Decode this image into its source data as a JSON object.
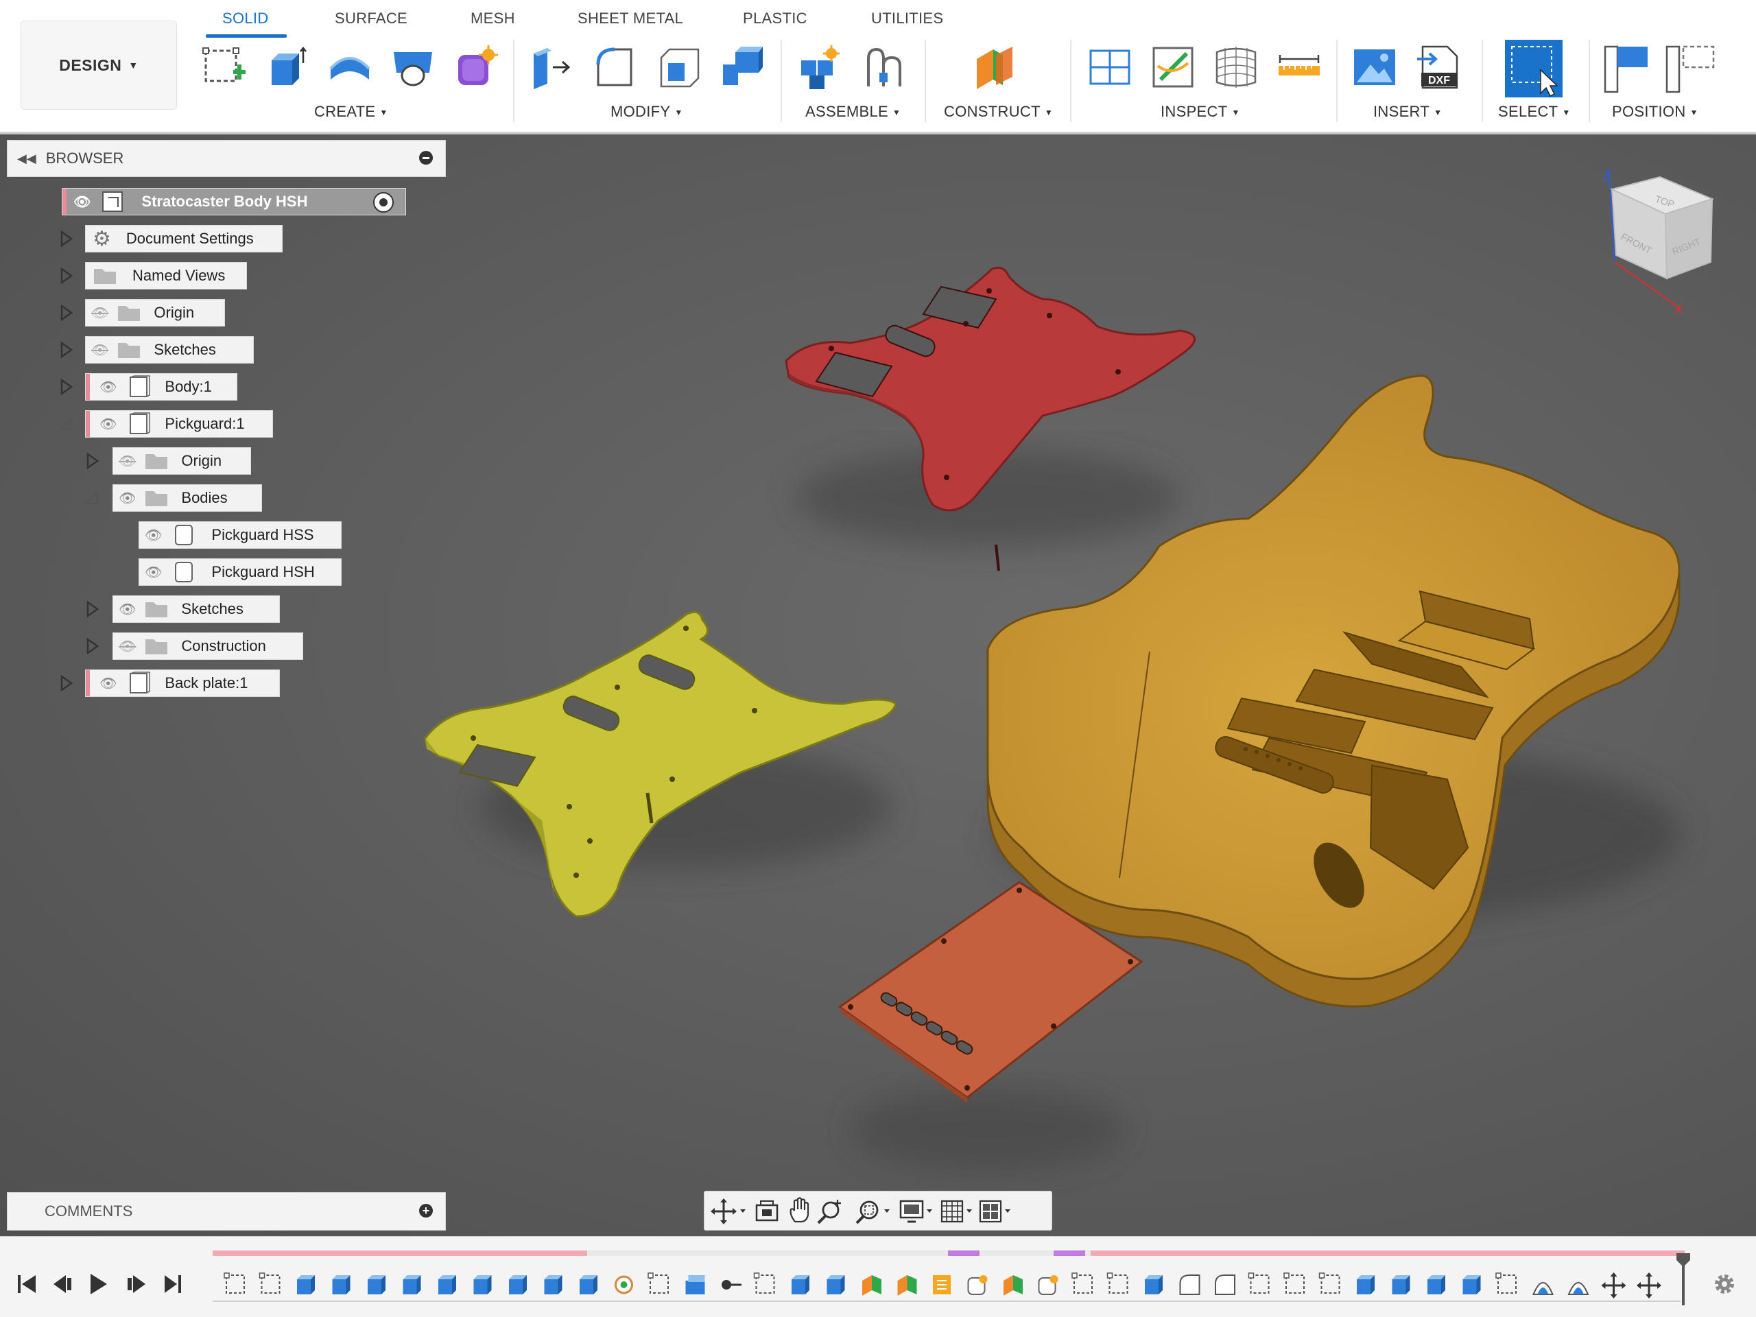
{
  "app": {
    "workspace_menu": "DESIGN"
  },
  "toolbar": {
    "tabs": [
      {
        "label": "SOLID",
        "active": true
      },
      {
        "label": "SURFACE",
        "active": false
      },
      {
        "label": "MESH",
        "active": false
      },
      {
        "label": "SHEET METAL",
        "active": false
      },
      {
        "label": "PLASTIC",
        "active": false
      },
      {
        "label": "UTILITIES",
        "active": false
      }
    ],
    "groups": [
      {
        "label": "CREATE",
        "tools": [
          "create-sketch-icon",
          "extrude-icon",
          "revolve-icon",
          "hole-icon",
          "create-form-icon"
        ]
      },
      {
        "label": "MODIFY",
        "tools": [
          "press-pull-icon",
          "fillet-icon",
          "shell-icon",
          "combine-icon"
        ]
      },
      {
        "label": "ASSEMBLE",
        "tools": [
          "new-component-icon",
          "joint-icon"
        ]
      },
      {
        "label": "CONSTRUCT",
        "tools": [
          "offset-plane-icon"
        ]
      },
      {
        "label": "INSPECT",
        "tools": [
          "section-analysis-icon",
          "zebra-analysis-icon",
          "curvature-map-icon",
          "measure-icon"
        ]
      },
      {
        "label": "INSERT",
        "tools": [
          "insert-image-icon",
          "insert-dxf-icon"
        ]
      },
      {
        "label": "SELECT",
        "tools": [
          "select-icon"
        ]
      },
      {
        "label": "POSITION",
        "tools": [
          "capture-position-icon",
          "revert-position-icon"
        ]
      }
    ],
    "dxf_badge": "DXF"
  },
  "browser": {
    "title": "BROWSER",
    "root": "Stratocaster Body HSH",
    "items": [
      {
        "label": "Document Settings",
        "icon": "gear-icon"
      },
      {
        "label": "Named Views",
        "icon": "folder-icon"
      },
      {
        "label": "Origin",
        "icon": "folder-icon",
        "hidden": true
      },
      {
        "label": "Sketches",
        "icon": "folder-icon",
        "hidden": true
      },
      {
        "label": "Body:1",
        "icon": "component-icon"
      },
      {
        "label": "Pickguard:1",
        "icon": "component-icon",
        "expanded": true
      },
      {
        "label": "Origin",
        "icon": "folder-icon",
        "hidden": true
      },
      {
        "label": "Bodies",
        "icon": "folder-icon",
        "expanded": true
      },
      {
        "label": "Pickguard HSS",
        "icon": "body-icon"
      },
      {
        "label": "Pickguard HSH",
        "icon": "body-icon"
      },
      {
        "label": "Sketches",
        "icon": "folder-icon"
      },
      {
        "label": "Construction",
        "icon": "folder-icon",
        "hidden": true
      },
      {
        "label": "Back plate:1",
        "icon": "component-icon"
      }
    ]
  },
  "viewcube": {
    "faces": [
      "TOP",
      "FRONT",
      "RIGHT"
    ],
    "axes": [
      "Z",
      "X"
    ]
  },
  "viewport": {
    "models": [
      {
        "name": "Pickguard HSH",
        "color": "#b83a3a"
      },
      {
        "name": "Pickguard HSS",
        "color": "#c8c43a"
      },
      {
        "name": "Stratocaster body",
        "color": "#c9952f"
      },
      {
        "name": "Back plate",
        "color": "#c5603f"
      }
    ]
  },
  "comments": {
    "title": "COMMENTS"
  },
  "navbar": {
    "tools": [
      "orbit-icon",
      "look-at-icon",
      "pan-icon",
      "zoom-icon",
      "fit-icon",
      "display-settings-icon",
      "grid-icon",
      "viewports-icon"
    ]
  },
  "timeline": {
    "controls": [
      "first-step-icon",
      "previous-step-icon",
      "play-icon",
      "next-step-icon",
      "last-step-icon"
    ],
    "settings": "gear-icon"
  },
  "colors": {
    "accent": "#1a73c9",
    "component_marker": "#e88c9a",
    "background": "#5a5a5a"
  }
}
